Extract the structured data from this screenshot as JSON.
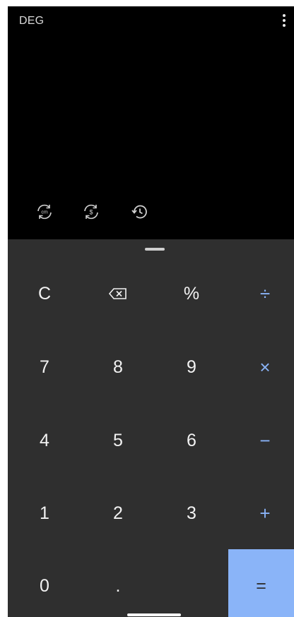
{
  "display": {
    "angle_mode": "DEG",
    "tools": [
      "unit-converter-icon",
      "currency-converter-icon",
      "history-icon"
    ]
  },
  "keypad": {
    "row1": [
      "C",
      "backspace-icon",
      "%",
      "÷"
    ],
    "row2": [
      "7",
      "8",
      "9",
      "×"
    ],
    "row3": [
      "4",
      "5",
      "6",
      "−"
    ],
    "row4": [
      "1",
      "2",
      "3",
      "+"
    ],
    "row5": [
      "0",
      ".",
      "",
      "="
    ]
  },
  "colors": {
    "display_bg": "#000000",
    "keypad_bg": "#2f2f2f",
    "digit_text": "#f2f2f2",
    "operator_accent": "#8ab4f8"
  }
}
